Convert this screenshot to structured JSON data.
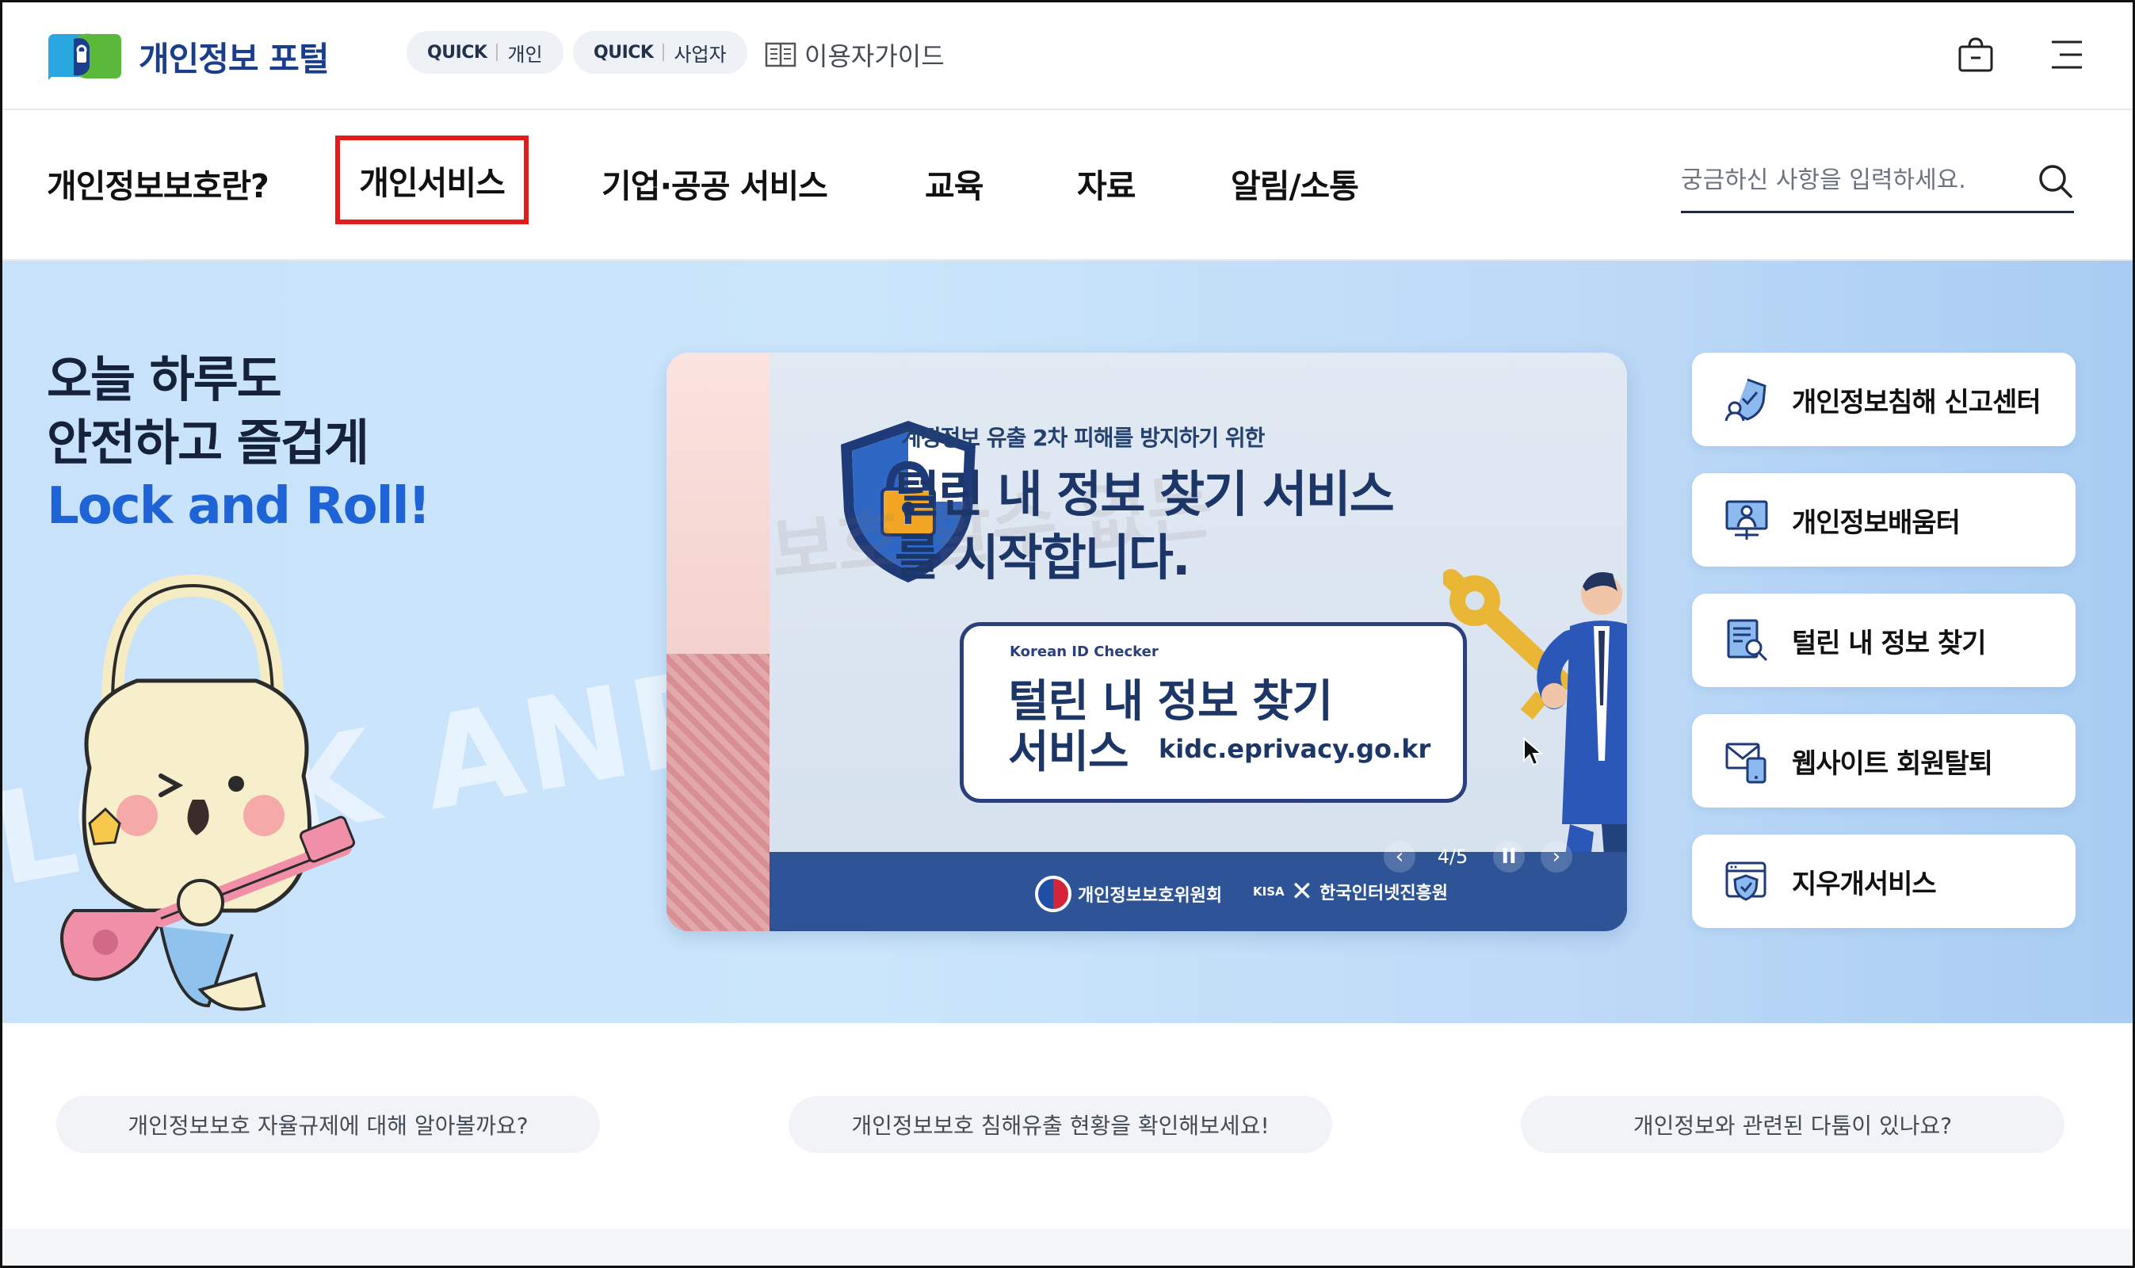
{
  "header": {
    "logo_text": "개인정보 포털",
    "quick_personal": {
      "tag": "QUICK",
      "label": "개인"
    },
    "quick_business": {
      "tag": "QUICK",
      "label": "사업자"
    },
    "user_guide": "이용자가이드"
  },
  "gnb": {
    "items": [
      {
        "label": "개인정보보호란?"
      },
      {
        "label": "개인서비스",
        "highlighted": true
      },
      {
        "label": "기업·공공 서비스"
      },
      {
        "label": "교육"
      },
      {
        "label": "자료"
      },
      {
        "label": "알림/소통"
      }
    ],
    "search": {
      "placeholder": "궁금하신 사항을 입력하세요."
    }
  },
  "hero": {
    "line1": "오늘 하루도",
    "line2": "안전하고 즐겁게",
    "line3": "Lock and Roll!",
    "bg_word": "LOCK AND ROLL"
  },
  "banner": {
    "subtitle": "계정정보 유출 2차 피해를 방지하기 위한",
    "title_line1": "털린 내 정보 찾기 서비스",
    "title_line2": "를 시작합니다.",
    "card_label": "Korean ID Checker",
    "card_title_line1": "털린 내 정보 찾기",
    "card_title_line2": "서비스",
    "card_url": "kidc.eprivacy.go.kr",
    "org1": "개인정보보호위원회",
    "org2_prefix": "KISA",
    "org2": "한국인터넷진흥원",
    "counter": "4/5",
    "prev_symbol": "‹",
    "pause_symbol": "II",
    "next_symbol": "›"
  },
  "side_menu": [
    {
      "label": "개인정보침해 신고센터",
      "icon": "shield-user-icon"
    },
    {
      "label": "개인정보배움터",
      "icon": "monitor-presenter-icon"
    },
    {
      "label": "털린 내 정보 찾기",
      "icon": "document-search-icon"
    },
    {
      "label": "웹사이트 회원탈퇴",
      "icon": "mail-phone-icon"
    },
    {
      "label": "지우개서비스",
      "icon": "browser-shield-icon"
    }
  ],
  "bottom_links": [
    "개인정보보호 자율규제에 대해 알아볼까요?",
    "개인정보보호 침해유출 현황을 확인해보세요!",
    "개인정보와 관련된 다툼이 있나요?"
  ],
  "colors": {
    "brand_navy": "#1a3e8c",
    "accent_blue": "#1e64d6",
    "highlight_red": "#e21b1b",
    "banner_footer": "#2e5497"
  }
}
